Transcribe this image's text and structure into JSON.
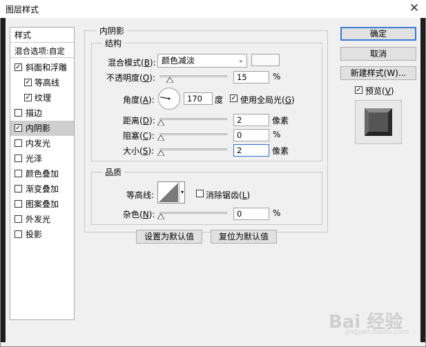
{
  "window": {
    "title": "图层样式",
    "close_glyph": "✕"
  },
  "sidebar": {
    "header": "样式",
    "blend_options": "混合选项:自定",
    "items": [
      {
        "label": "斜面和浮雕",
        "checked": true,
        "sub": false,
        "selected": false
      },
      {
        "label": "等高线",
        "checked": true,
        "sub": true,
        "selected": false
      },
      {
        "label": "纹理",
        "checked": true,
        "sub": true,
        "selected": false
      },
      {
        "label": "描边",
        "checked": false,
        "sub": false,
        "selected": false
      },
      {
        "label": "内阴影",
        "checked": true,
        "sub": false,
        "selected": true
      },
      {
        "label": "内发光",
        "checked": false,
        "sub": false,
        "selected": false
      },
      {
        "label": "光泽",
        "checked": false,
        "sub": false,
        "selected": false
      },
      {
        "label": "颜色叠加",
        "checked": false,
        "sub": false,
        "selected": false
      },
      {
        "label": "渐变叠加",
        "checked": false,
        "sub": false,
        "selected": false
      },
      {
        "label": "图案叠加",
        "checked": false,
        "sub": false,
        "selected": false
      },
      {
        "label": "外发光",
        "checked": false,
        "sub": false,
        "selected": false
      },
      {
        "label": "投影",
        "checked": false,
        "sub": false,
        "selected": false
      }
    ]
  },
  "inner_shadow": {
    "section_title": "内阴影",
    "structure": {
      "title": "结构",
      "blend_mode_label": "混合模式(",
      "blend_mode_key": "B",
      "blend_mode_value": "颜色减淡",
      "opacity_label": "不透明度(",
      "opacity_key": "O",
      "opacity_value": "15",
      "opacity_unit": "%",
      "opacity_level": 15,
      "angle_label": "角度(",
      "angle_key": "A",
      "angle_value": "170",
      "angle_unit": "度",
      "global_light_label": "使用全局光(",
      "global_light_key": "G",
      "global_light_checked": true,
      "distance_label": "距离(",
      "distance_key": "D",
      "distance_value": "2",
      "distance_unit": "像素",
      "choke_label": "阻塞(",
      "choke_key": "C",
      "choke_value": "0",
      "choke_unit": "%",
      "size_label": "大小(",
      "size_key": "S",
      "size_value": "2",
      "size_unit": "像素"
    },
    "quality": {
      "title": "品质",
      "contour_label": "等高线:",
      "antialias_label": "消除锯齿(",
      "antialias_key": "L",
      "antialias_checked": false,
      "noise_label": "杂色(",
      "noise_key": "N",
      "noise_value": "0",
      "noise_unit": "%"
    },
    "set_default_label": "设置为默认值",
    "reset_default_label": "复位为默认值"
  },
  "actions": {
    "ok_label": "确定",
    "cancel_label": "取消",
    "new_style_label": "新建样式(W)...",
    "preview_label": "预览(",
    "preview_key": "V",
    "preview_checked": true
  },
  "colors": {
    "accent": "#3a78d6",
    "selected_row": "#cfcfcf"
  },
  "watermark": {
    "text": "Bai 经验",
    "sub": "jingyan.baidu.com"
  }
}
